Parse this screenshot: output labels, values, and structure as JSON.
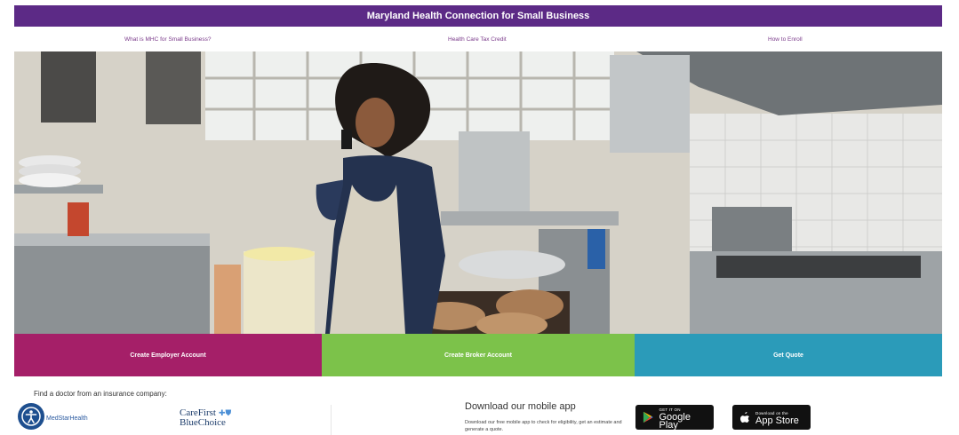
{
  "header": {
    "title": "Maryland Health Connection for Small Business"
  },
  "nav": {
    "links": [
      {
        "label": "What is MHC for Small Business?"
      },
      {
        "label": "Health Care Tax Credit"
      },
      {
        "label": "How to Enroll"
      }
    ]
  },
  "cta": {
    "employer_label": "Create Employer Account",
    "broker_label": "Create Broker Account",
    "quote_label": "Get Quote"
  },
  "partners": {
    "heading": "Find a doctor from an insurance company:",
    "partner1": "MedStarHealth",
    "partner2_line1": "CareFirst",
    "partner2_line2": "BlueChoice"
  },
  "app": {
    "title": "Download our mobile app",
    "description": "Download our free mobile app to check for eligibility, get an estimate and generate a quote.",
    "google_small": "GET IT ON",
    "google_big": "Google Play",
    "apple_small": "Download on the",
    "apple_big": "App Store"
  },
  "colors": {
    "header": "#5c2a86",
    "employer": "#a51f68",
    "broker": "#7cc24a",
    "quote": "#2b9bb9"
  }
}
